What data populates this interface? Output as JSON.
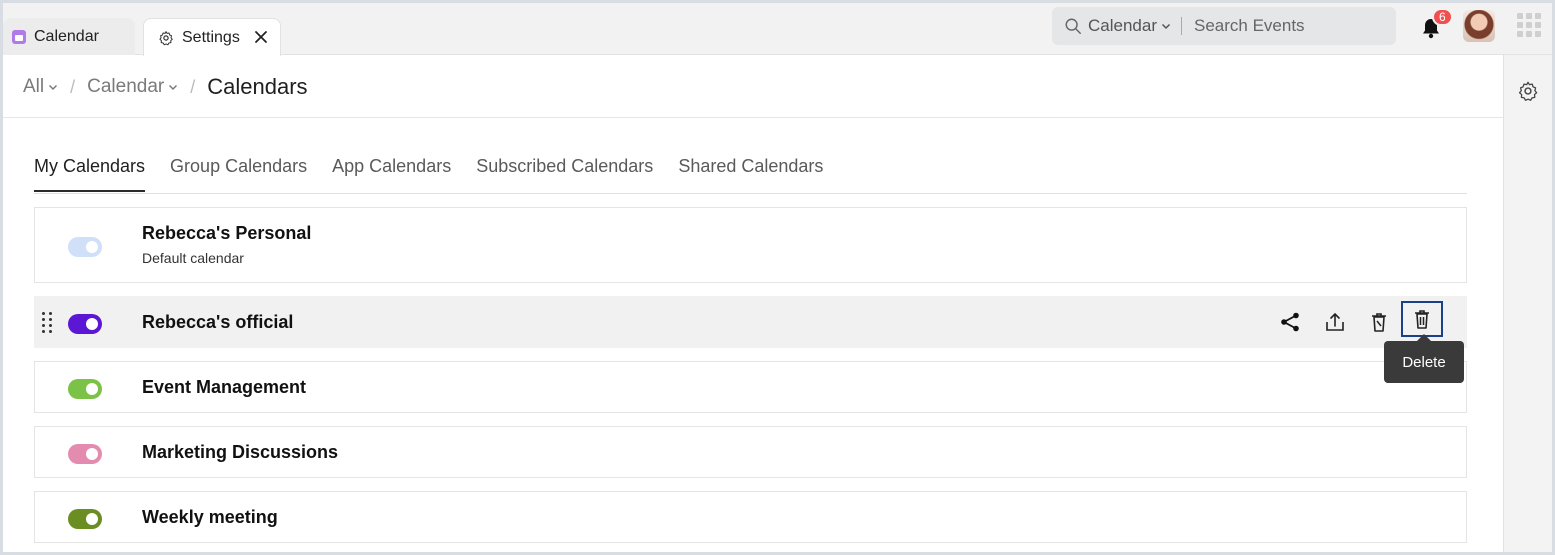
{
  "tabs": {
    "calendar_label": "Calendar",
    "settings_label": "Settings"
  },
  "search": {
    "scope": "Calendar",
    "placeholder": "Search Events"
  },
  "notifications": {
    "count": "6"
  },
  "breadcrumb": {
    "all": "All",
    "calendar": "Calendar",
    "current": "Calendars"
  },
  "calendar_tabs": [
    {
      "label": "My Calendars",
      "active": true
    },
    {
      "label": "Group Calendars",
      "active": false
    },
    {
      "label": "App Calendars",
      "active": false
    },
    {
      "label": "Subscribed Calendars",
      "active": false
    },
    {
      "label": "Shared Calendars",
      "active": false
    }
  ],
  "calendars": [
    {
      "name": "Rebecca's Personal",
      "subtitle": "Default calendar",
      "color": "#cfe0f8",
      "enabled": true
    },
    {
      "name": "Rebecca's official",
      "subtitle": "",
      "color": "#5b16d6",
      "enabled": true
    },
    {
      "name": "Event Management",
      "subtitle": "",
      "color": "#7cc247",
      "enabled": true
    },
    {
      "name": "Marketing Discussions",
      "subtitle": "",
      "color": "#e48bb0",
      "enabled": true
    },
    {
      "name": "Weekly meeting",
      "subtitle": "",
      "color": "#6b8e23",
      "enabled": true
    }
  ],
  "row_actions": {
    "share_icon": "share-icon",
    "export_icon": "export-icon",
    "clear_icon": "clear-icon",
    "delete_icon": "delete-icon"
  },
  "tooltip": {
    "text": "Delete"
  }
}
